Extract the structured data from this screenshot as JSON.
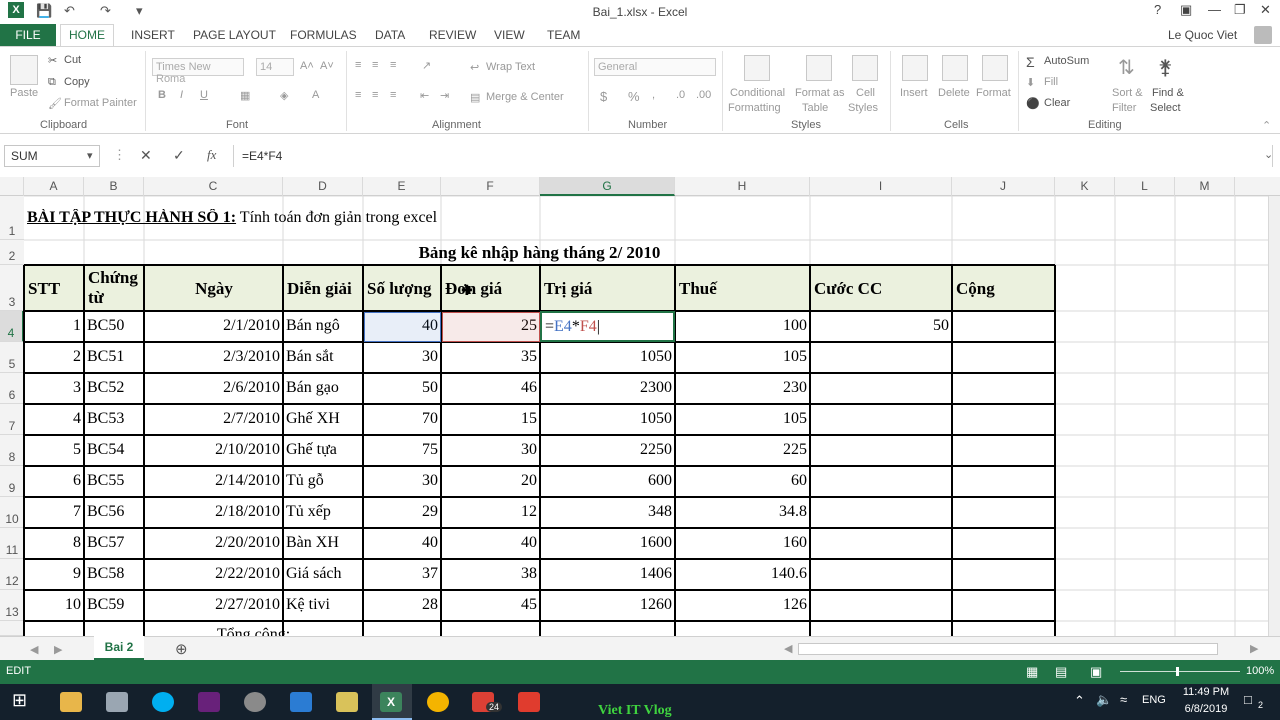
{
  "window": {
    "title": "Bai_1.xlsx - Excel",
    "user": "Le Quoc Viet"
  },
  "tabs": [
    "FILE",
    "HOME",
    "INSERT",
    "PAGE LAYOUT",
    "FORMULAS",
    "DATA",
    "REVIEW",
    "VIEW",
    "TEAM"
  ],
  "ribbon": {
    "clipboard": {
      "label": "Clipboard",
      "paste": "Paste",
      "cut": "Cut",
      "copy": "Copy",
      "format_painter": "Format Painter"
    },
    "font": {
      "label": "Font",
      "name": "Times New Roma",
      "size": "14"
    },
    "alignment": {
      "label": "Alignment",
      "wrap": "Wrap Text",
      "merge": "Merge & Center"
    },
    "number": {
      "label": "Number",
      "format": "General"
    },
    "styles": {
      "label": "Styles",
      "cond": "Conditional",
      "cond2": "Formatting",
      "fmt_table": "Format as",
      "fmt_table2": "Table",
      "cell": "Cell",
      "cell2": "Styles"
    },
    "cells": {
      "label": "Cells",
      "insert": "Insert",
      "delete": "Delete",
      "format": "Format"
    },
    "editing": {
      "label": "Editing",
      "autosum": "AutoSum",
      "fill": "Fill",
      "clear": "Clear",
      "sort": "Sort &",
      "sort2": "Filter",
      "find": "Find &",
      "find2": "Select"
    }
  },
  "formula_bar": {
    "name_box": "SUM",
    "formula": "=E4*F4",
    "fx": "fx"
  },
  "columns": [
    "A",
    "B",
    "C",
    "D",
    "E",
    "F",
    "G",
    "H",
    "I",
    "J",
    "K",
    "L",
    "M"
  ],
  "rows": [
    "1",
    "2",
    "3",
    "4",
    "5",
    "6",
    "7",
    "8",
    "9",
    "10",
    "11",
    "12",
    "13"
  ],
  "sheet": {
    "title_bold": "BÀI TẬP THỰC HÀNH SỐ 1:",
    "title_rest": " Tính toán đơn giản trong excel",
    "subtitle": "Bảng kê nhập hàng  tháng 2/ 2010",
    "headers": [
      "STT",
      "Chứng từ",
      "Ngày",
      "Diễn giải",
      "Số lượng",
      "Đơn giá",
      "Trị giá",
      "Thuế",
      "Cước CC",
      "Cộng"
    ],
    "data": [
      [
        "1",
        "BC50",
        "2/1/2010",
        "Bán ngô",
        "40",
        "25",
        "",
        "100",
        "50",
        ""
      ],
      [
        "2",
        "BC51",
        "2/3/2010",
        "Bán sắt",
        "30",
        "35",
        "1050",
        "105",
        "",
        ""
      ],
      [
        "3",
        "BC52",
        "2/6/2010",
        "Bán gạo",
        "50",
        "46",
        "2300",
        "230",
        "",
        ""
      ],
      [
        "4",
        "BC53",
        "2/7/2010",
        "Ghế XH",
        "70",
        "15",
        "1050",
        "105",
        "",
        ""
      ],
      [
        "5",
        "BC54",
        "2/10/2010",
        "Ghế tựa",
        "75",
        "30",
        "2250",
        "225",
        "",
        ""
      ],
      [
        "6",
        "BC55",
        "2/14/2010",
        "Tủ gỗ",
        "30",
        "20",
        "600",
        "60",
        "",
        ""
      ],
      [
        "7",
        "BC56",
        "2/18/2010",
        "Tủ xếp",
        "29",
        "12",
        "348",
        "34.8",
        "",
        ""
      ],
      [
        "8",
        "BC57",
        "2/20/2010",
        "Bàn XH",
        "40",
        "40",
        "1600",
        "160",
        "",
        ""
      ],
      [
        "9",
        "BC58",
        "2/22/2010",
        "Giá sách",
        "37",
        "38",
        "1406",
        "140.6",
        "",
        ""
      ],
      [
        "10",
        "BC59",
        "2/27/2010",
        "Kệ tivi",
        "28",
        "45",
        "1260",
        "126",
        "",
        ""
      ]
    ],
    "edit_cell": {
      "eq": "=",
      "a": "E4",
      "op": "*",
      "b": "F4"
    },
    "total_label": "Tổng cộng:"
  },
  "sheet_tabs": [
    "Bai 2"
  ],
  "status": {
    "mode": "EDIT",
    "zoom": "100%"
  },
  "taskbar": {
    "lang": "ENG",
    "time": "11:49 PM",
    "date": "6/8/2019",
    "watermark": "Viet IT Vlog",
    "badge": "24",
    "notif": "2"
  },
  "colors": {
    "excel_green": "#217346",
    "header_fill": "#ebf1de",
    "ref_blue": "#4472c4",
    "ref_red": "#c0504d"
  }
}
